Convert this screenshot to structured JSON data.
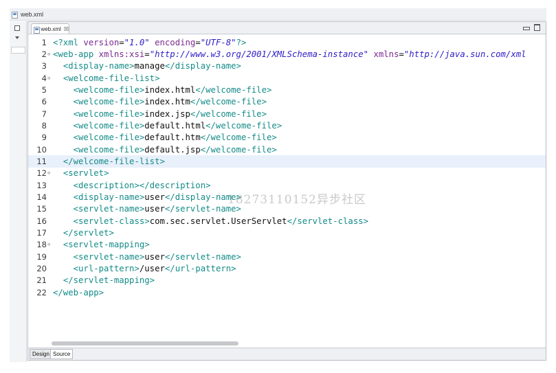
{
  "window": {
    "title": "web.xml"
  },
  "editor": {
    "tab_label": "web.xml",
    "close_glyph": "☒",
    "icons": {
      "file": "xml-file-icon",
      "minimize": "minimize-icon",
      "maximize": "maximize-icon"
    }
  },
  "watermark": "18273110152异步社区",
  "code": {
    "current_line": 11,
    "lines": [
      {
        "n": "1",
        "fold": "",
        "segs": [
          [
            "decl",
            "<?xml "
          ],
          [
            "attr-name",
            "version"
          ],
          [
            "txt",
            "="
          ],
          [
            "attr-value",
            "\"1.0\""
          ],
          [
            "txt",
            " "
          ],
          [
            "attr-name",
            "encoding"
          ],
          [
            "txt",
            "="
          ],
          [
            "attr-value",
            "\"UTF-8\""
          ],
          [
            "decl",
            "?>"
          ]
        ]
      },
      {
        "n": "2",
        "fold": "⊖",
        "segs": [
          [
            "tag",
            "<web-app "
          ],
          [
            "attr-name",
            "xmlns:xsi"
          ],
          [
            "txt",
            "="
          ],
          [
            "attr-value",
            "\"http://www.w3.org/2001/XMLSchema-instance\""
          ],
          [
            "txt",
            " "
          ],
          [
            "attr-name",
            "xmlns"
          ],
          [
            "txt",
            "="
          ],
          [
            "attr-value",
            "\"http://java.sun.com/xml"
          ]
        ]
      },
      {
        "n": "3",
        "fold": "",
        "segs": [
          [
            "txt",
            "  "
          ],
          [
            "tag",
            "<display-name>"
          ],
          [
            "txt",
            "manage"
          ],
          [
            "tag",
            "</display-name>"
          ]
        ]
      },
      {
        "n": "4",
        "fold": "⊖",
        "segs": [
          [
            "txt",
            "  "
          ],
          [
            "tag",
            "<welcome-file-list>"
          ]
        ]
      },
      {
        "n": "5",
        "fold": "",
        "segs": [
          [
            "txt",
            "    "
          ],
          [
            "tag",
            "<welcome-file>"
          ],
          [
            "txt",
            "index.html"
          ],
          [
            "tag",
            "</welcome-file>"
          ]
        ]
      },
      {
        "n": "6",
        "fold": "",
        "segs": [
          [
            "txt",
            "    "
          ],
          [
            "tag",
            "<welcome-file>"
          ],
          [
            "txt",
            "index.htm"
          ],
          [
            "tag",
            "</welcome-file>"
          ]
        ]
      },
      {
        "n": "7",
        "fold": "",
        "segs": [
          [
            "txt",
            "    "
          ],
          [
            "tag",
            "<welcome-file>"
          ],
          [
            "txt",
            "index.jsp"
          ],
          [
            "tag",
            "</welcome-file>"
          ]
        ]
      },
      {
        "n": "8",
        "fold": "",
        "segs": [
          [
            "txt",
            "    "
          ],
          [
            "tag",
            "<welcome-file>"
          ],
          [
            "txt",
            "default.html"
          ],
          [
            "tag",
            "</welcome-file>"
          ]
        ]
      },
      {
        "n": "9",
        "fold": "",
        "segs": [
          [
            "txt",
            "    "
          ],
          [
            "tag",
            "<welcome-file>"
          ],
          [
            "txt",
            "default.htm"
          ],
          [
            "tag",
            "</welcome-file>"
          ]
        ]
      },
      {
        "n": "10",
        "fold": "",
        "segs": [
          [
            "txt",
            "    "
          ],
          [
            "tag",
            "<welcome-file>"
          ],
          [
            "txt",
            "default.jsp"
          ],
          [
            "tag",
            "</welcome-file>"
          ]
        ]
      },
      {
        "n": "11",
        "fold": "",
        "segs": [
          [
            "txt",
            "  "
          ],
          [
            "tag",
            "</welcome-file-list>"
          ]
        ]
      },
      {
        "n": "12",
        "fold": "⊖",
        "segs": [
          [
            "txt",
            "  "
          ],
          [
            "tag",
            "<servlet>"
          ]
        ]
      },
      {
        "n": "13",
        "fold": "",
        "segs": [
          [
            "txt",
            "    "
          ],
          [
            "tag",
            "<description></description>"
          ]
        ]
      },
      {
        "n": "14",
        "fold": "",
        "segs": [
          [
            "txt",
            "    "
          ],
          [
            "tag",
            "<display-name>"
          ],
          [
            "txt",
            "user"
          ],
          [
            "tag",
            "</display-name>"
          ]
        ]
      },
      {
        "n": "15",
        "fold": "",
        "segs": [
          [
            "txt",
            "    "
          ],
          [
            "tag",
            "<servlet-name>"
          ],
          [
            "txt",
            "user"
          ],
          [
            "tag",
            "</servlet-name>"
          ]
        ]
      },
      {
        "n": "16",
        "fold": "",
        "segs": [
          [
            "txt",
            "    "
          ],
          [
            "tag",
            "<servlet-class>"
          ],
          [
            "txt",
            "com.sec.servlet.UserServlet"
          ],
          [
            "tag",
            "</servlet-class>"
          ]
        ]
      },
      {
        "n": "17",
        "fold": "",
        "segs": [
          [
            "txt",
            "  "
          ],
          [
            "tag",
            "</servlet>"
          ]
        ]
      },
      {
        "n": "18",
        "fold": "⊖",
        "segs": [
          [
            "txt",
            "  "
          ],
          [
            "tag",
            "<servlet-mapping>"
          ]
        ]
      },
      {
        "n": "19",
        "fold": "",
        "segs": [
          [
            "txt",
            "    "
          ],
          [
            "tag",
            "<servlet-name>"
          ],
          [
            "txt",
            "user"
          ],
          [
            "tag",
            "</servlet-name>"
          ]
        ]
      },
      {
        "n": "20",
        "fold": "",
        "segs": [
          [
            "txt",
            "    "
          ],
          [
            "tag",
            "<url-pattern>"
          ],
          [
            "txt",
            "/user"
          ],
          [
            "tag",
            "</url-pattern>"
          ]
        ]
      },
      {
        "n": "21",
        "fold": "",
        "segs": [
          [
            "txt",
            "  "
          ],
          [
            "tag",
            "</servlet-mapping>"
          ]
        ]
      },
      {
        "n": "22",
        "fold": "",
        "segs": [
          [
            "tag",
            "</web-app>"
          ]
        ]
      }
    ]
  },
  "page_tabs": [
    {
      "label": "Design",
      "active": false
    },
    {
      "label": "Source",
      "active": true
    }
  ]
}
